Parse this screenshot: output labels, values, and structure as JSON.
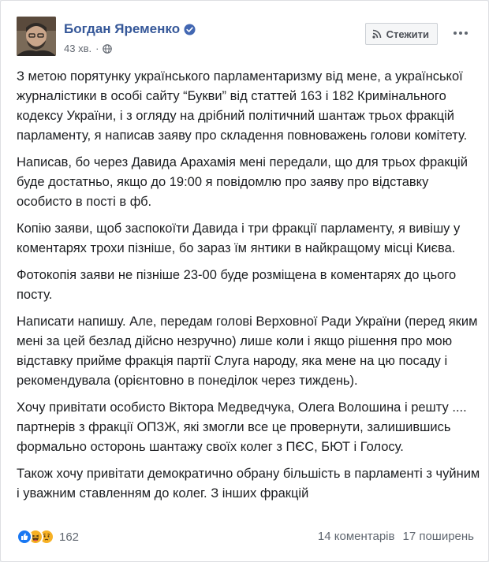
{
  "post": {
    "author_name": "Богдан Яременко",
    "timestamp": "43 хв.",
    "meta_separator": "·",
    "follow_label": "Стежити",
    "paragraphs": [
      "З метою порятунку українського парламентаризму від мене, а української журналістики в особі сайту “Букви” від статтей 163 і 182 Кримінального кодексу України, і з огляду на дрібний політичний шантаж трьох фракцій парламенту, я написав заяву про складення повноважень голови комітету.",
      "Написав, бо через Давида Арахамія мені передали, що для трьох фракцій буде достатньо, якщо до 19:00 я повідомлю про заяву про відставку особисто в пості в фб.",
      "Копію заяви, щоб заспокоїти Давида і три фракції парламенту, я вивішу у коментарях трохи пізніше, бо зараз їм янтики в найкращому місці Києва.",
      "Фотокопія заяви не пізніше 23-00 буде розміщена в коментарях до цього посту.",
      "Написати напишу. Але, передам голові Верховної Ради України (перед яким мені за цей безлад дійсно незручно) лише коли і якщо рішення про мою відставку прийме фракція партії Слуга народу, яка мене на цю посаду і рекомендувала (орієнтовно в понеділок через тиждень).",
      "Хочу привітати особисто Віктора Медведчука, Олега Волошина і решту .... партнерів з фракції ОПЗЖ, які змогли все це провернути, залишившись формально осторонь шантажу своїх колег з ПЄС, БЮТ і Голосу.",
      "Також хочу привітати демократично обрану більшість в парламенті з чуйним і уважним ставленням до колег. З інших фракцій"
    ],
    "reactions": {
      "icons": [
        "like-icon",
        "haha-icon",
        "sad-icon"
      ],
      "count": "162"
    },
    "comments_label": "14 коментарів",
    "shares_label": "17 поширень"
  },
  "colors": {
    "link": "#365899",
    "secondary_text": "#616770",
    "like_blue": "#1877f2",
    "emoji_yellow": "#f7b125"
  }
}
